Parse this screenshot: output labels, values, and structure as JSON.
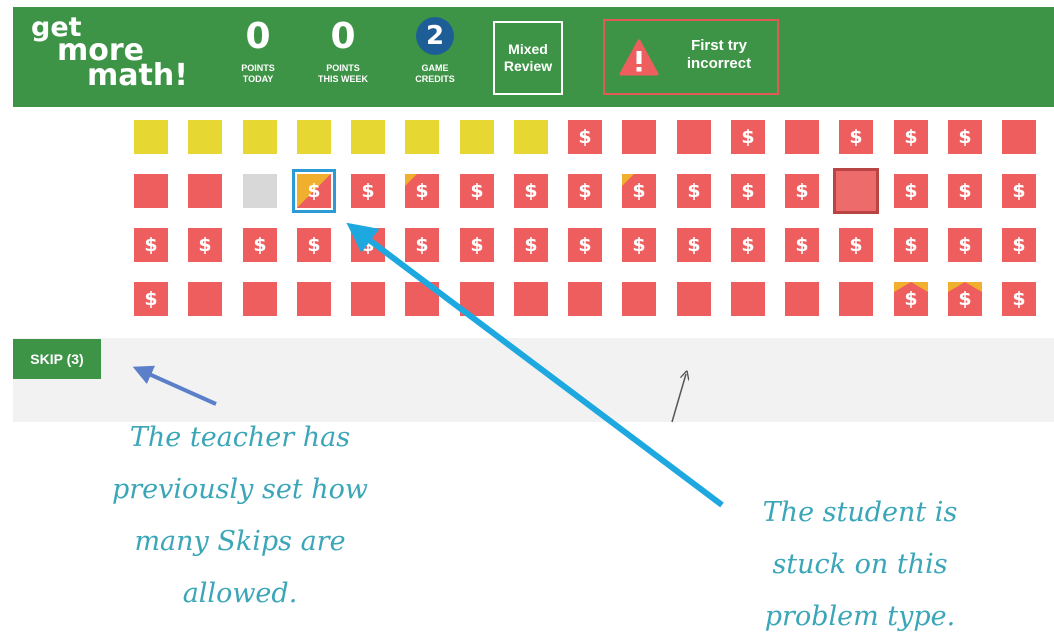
{
  "logo": {
    "line1": "get",
    "line2": "more",
    "line3": "math!"
  },
  "stats": {
    "points_today": {
      "value": "0",
      "label_1": "POINTS",
      "label_2": "TODAY"
    },
    "points_week": {
      "value": "0",
      "label_1": "POINTS",
      "label_2": "THIS WEEK"
    },
    "game_credits": {
      "value": "2",
      "label_1": "GAME",
      "label_2": "CREDITS"
    }
  },
  "mixed_review": {
    "line1": "Mixed",
    "line2": "Review"
  },
  "first_try": {
    "line1": "First try",
    "line2": "incorrect"
  },
  "skip_button": "SKIP (3)",
  "dollar": "$",
  "grid_rows": [
    [
      "yellow",
      "yellow",
      "yellow",
      "yellow",
      "yellow",
      "yellow",
      "yellow",
      "yellow",
      "red$",
      "red",
      "red",
      "red$",
      "red",
      "red$",
      "red$",
      "red$",
      "red"
    ],
    [
      "red",
      "red",
      "gray",
      "sel$",
      "red$",
      "red$c",
      "red$",
      "red$",
      "red$",
      "red$c",
      "red$",
      "red$",
      "red$",
      "dark",
      "red$",
      "red$",
      "red$"
    ],
    [
      "red$",
      "red$",
      "red$",
      "red$",
      "red$",
      "red$",
      "red$",
      "red$",
      "red$",
      "red$",
      "red$",
      "red$",
      "red$",
      "red$",
      "red$",
      "red$",
      "red$"
    ],
    [
      "red$",
      "red",
      "red",
      "red",
      "red",
      "red",
      "red",
      "red",
      "red",
      "red",
      "red",
      "red",
      "red",
      "red",
      "red$t",
      "red$t",
      "red$"
    ]
  ],
  "annotations": {
    "teacher": [
      "The teacher has",
      "previously set how",
      "many Skips are",
      "allowed."
    ],
    "student": [
      "The student is",
      "stuck on this",
      "problem type."
    ]
  },
  "colors": {
    "header_green": "#3e9446",
    "tile_red": "#ef5e5e",
    "tile_yellow": "#e6d733",
    "tile_gray": "#d8d8d8",
    "credit_blue": "#1d5e96",
    "arrow_blue": "#1ea8e0",
    "annotation_teal": "#3aa6b8"
  }
}
